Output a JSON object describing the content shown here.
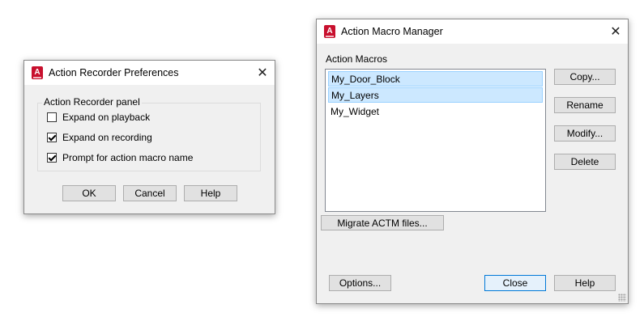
{
  "preferences_dialog": {
    "title": "Action Recorder Preferences",
    "close_glyph": "✕",
    "group_label": "Action Recorder panel",
    "options": [
      {
        "label": "Expand on playback",
        "checked": false
      },
      {
        "label": "Expand on recording",
        "checked": true
      },
      {
        "label": "Prompt for action macro name",
        "checked": true
      }
    ],
    "ok_label": "OK",
    "cancel_label": "Cancel",
    "help_label": "Help"
  },
  "manager_dialog": {
    "title": "Action Macro Manager",
    "close_glyph": "✕",
    "list_label": "Action Macros",
    "macros": [
      {
        "name": "My_Door_Block",
        "selected": true
      },
      {
        "name": "My_Layers",
        "selected": true
      },
      {
        "name": "My_Widget",
        "selected": false
      }
    ],
    "copy_label": "Copy...",
    "rename_label": "Rename",
    "modify_label": "Modify...",
    "delete_label": "Delete",
    "migrate_label": "Migrate ACTM files...",
    "options_label": "Options...",
    "close_label": "Close",
    "help_label": "Help"
  },
  "icons": {
    "app_icon": "autocad-icon",
    "app_icon_letter": "A",
    "app_icon_color": "#c8102e"
  }
}
